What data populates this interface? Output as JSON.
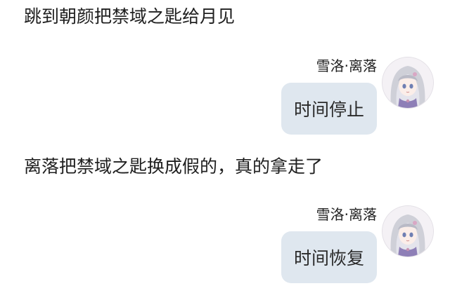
{
  "messages": [
    {
      "narration": "跳到朝颜把禁域之匙给月见"
    },
    {
      "sender": "雪洛·离落",
      "bubble": "时间停止",
      "avatar_icon": "anime-girl-avatar-icon"
    },
    {
      "narration": "离落把禁域之匙换成假的，真的拿走了"
    },
    {
      "sender": "雪洛·离落",
      "bubble": "时间恢复",
      "avatar_icon": "anime-girl-avatar-icon"
    }
  ],
  "colors": {
    "bubble_bg": "#dfe7ef",
    "text": "#222222",
    "background": "#ffffff"
  }
}
